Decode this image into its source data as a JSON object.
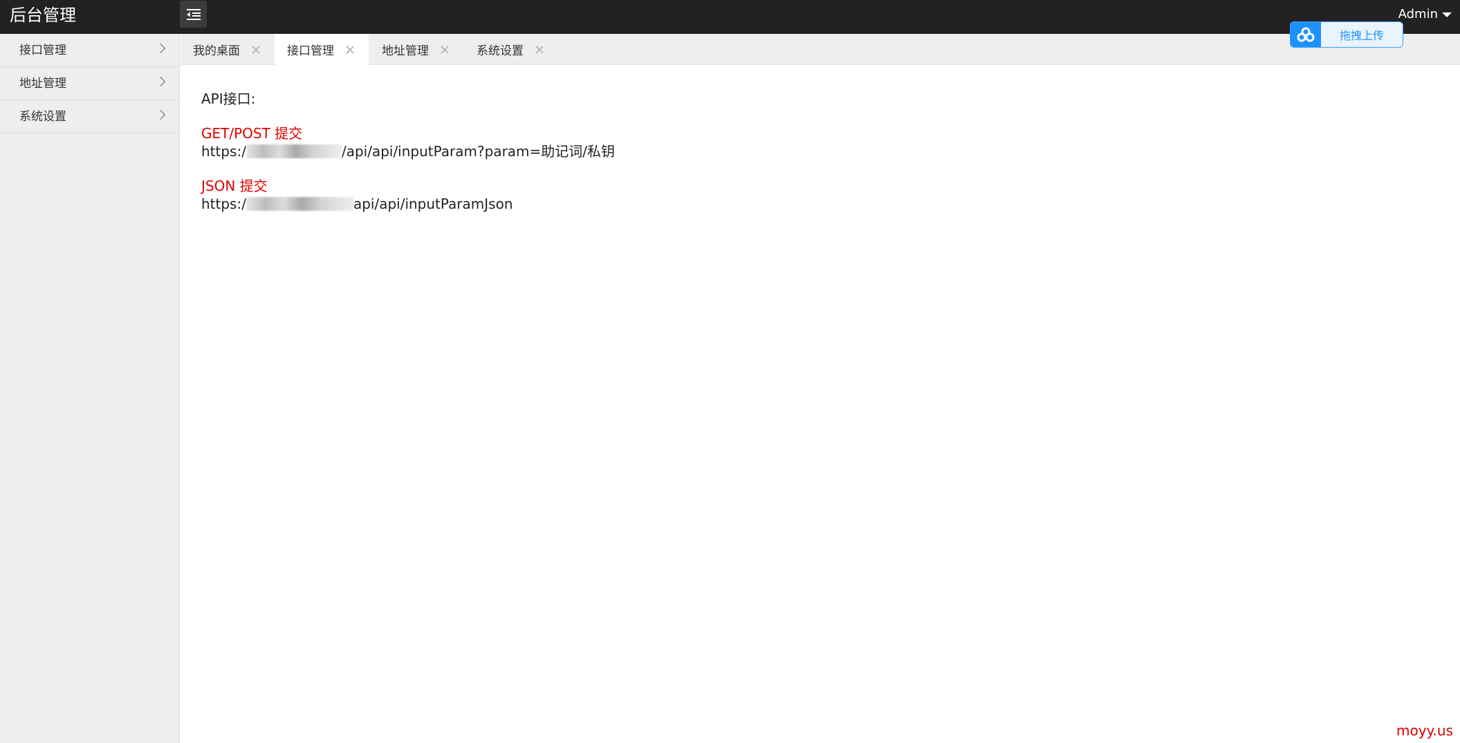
{
  "header": {
    "title": "后台管理",
    "menu_toggle_icon": "outdent-menu-icon",
    "user_label": "Admin"
  },
  "sidebar": {
    "items": [
      {
        "label": "接口管理"
      },
      {
        "label": "地址管理"
      },
      {
        "label": "系统设置"
      }
    ]
  },
  "tabs": [
    {
      "label": "我的桌面",
      "active": false
    },
    {
      "label": "接口管理",
      "active": true
    },
    {
      "label": "地址管理",
      "active": false
    },
    {
      "label": "系统设置",
      "active": false
    }
  ],
  "upload_widget": {
    "label": "拖拽上传",
    "icon": "baidu-cloud-icon",
    "accent": "#1e90ff"
  },
  "content": {
    "heading": "API接口:",
    "sections": [
      {
        "title": "GET/POST 提交",
        "url_prefix": "https:/",
        "url_suffix": "/api/api/inputParam?param=助记词/私钥"
      },
      {
        "title": "JSON 提交",
        "url_prefix": "https:/",
        "url_suffix": "api/api/inputParamJson"
      }
    ]
  },
  "watermark": "moyy.us",
  "colors": {
    "topbar": "#222222",
    "sidebar": "#eeeeee",
    "section_title": "#e00000"
  }
}
